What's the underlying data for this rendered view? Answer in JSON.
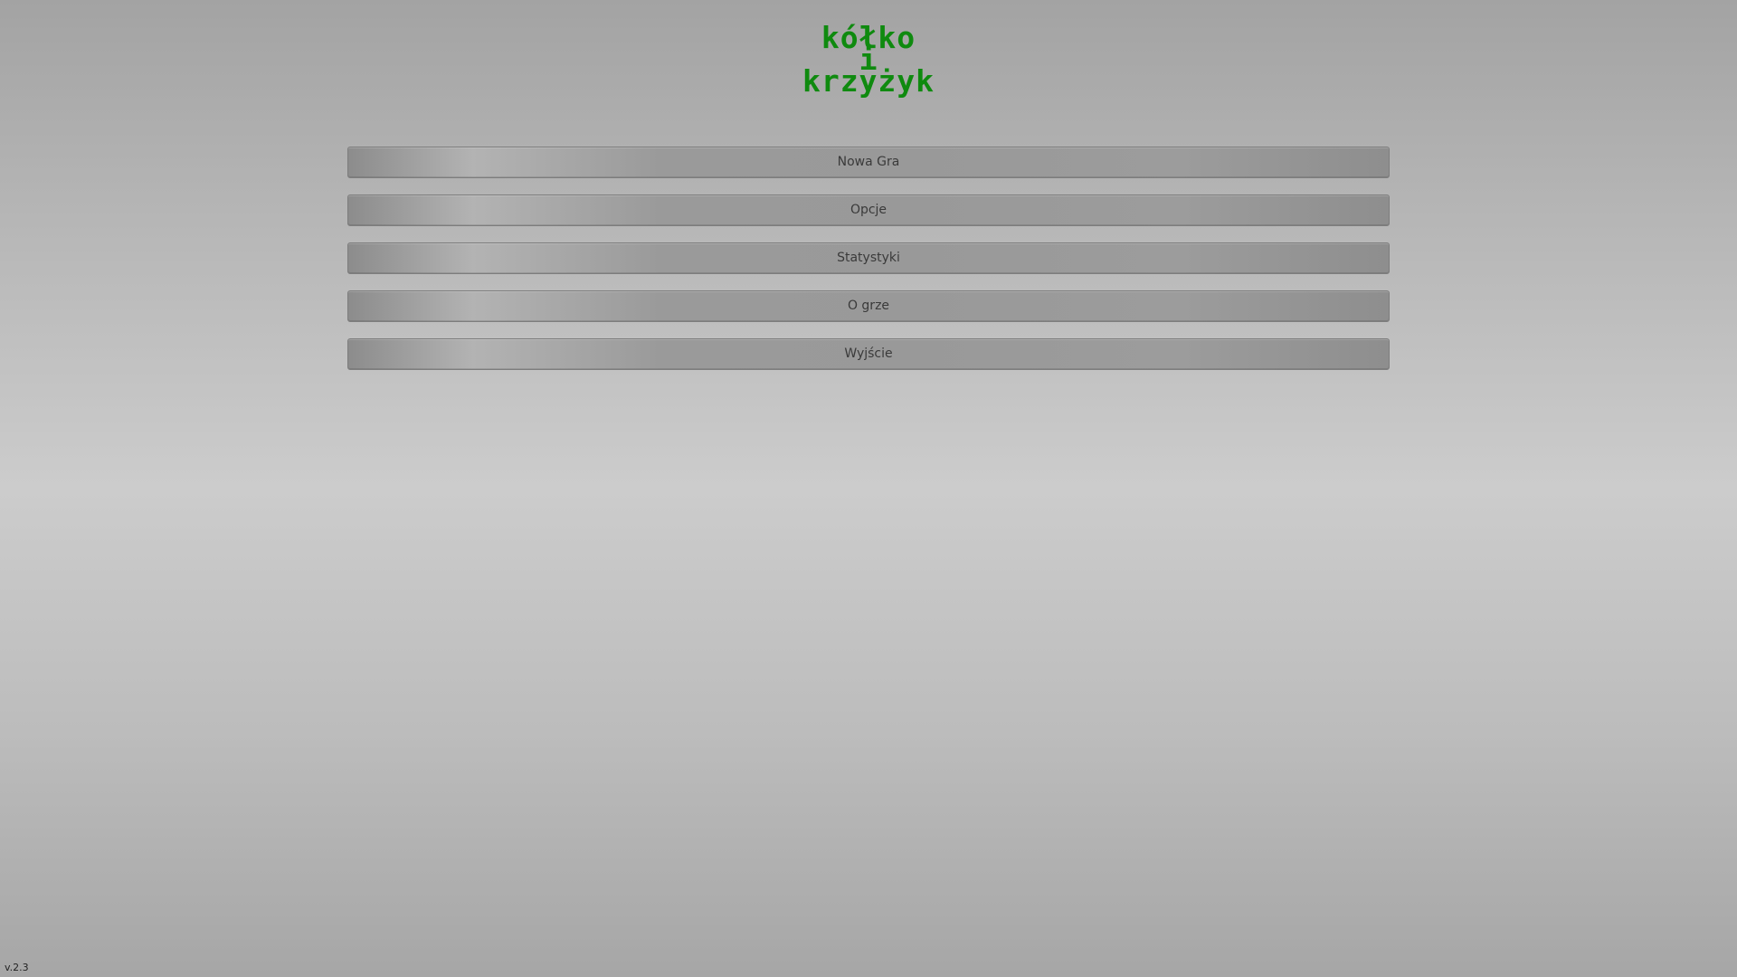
{
  "title": {
    "line1": "kółko",
    "line2": "i",
    "line3": "krzyżyk",
    "color": "#0f8a0f"
  },
  "menu": {
    "items": [
      {
        "label": "Nowa Gra"
      },
      {
        "label": "Opcje"
      },
      {
        "label": "Statystyki"
      },
      {
        "label": "O grze"
      },
      {
        "label": "Wyjście"
      }
    ]
  },
  "version": "v.2.3"
}
